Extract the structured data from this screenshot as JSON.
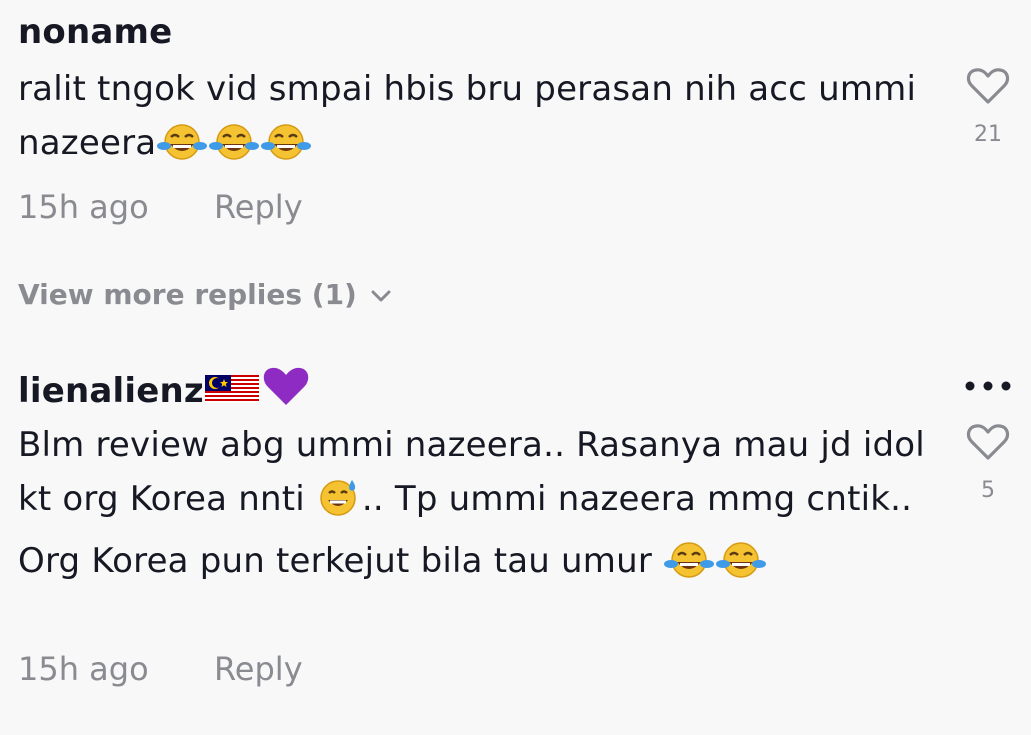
{
  "comments": [
    {
      "username": "noname",
      "text_parts": [
        "ralit tngok vid smpai hbis bru perasan nih acc ummi nazeera"
      ],
      "emojis": [
        "laughing-tears",
        "laughing-tears",
        "laughing-tears"
      ],
      "time": "15h ago",
      "reply_label": "Reply",
      "likes": "21"
    },
    {
      "username": "lienalienz",
      "username_emojis": [
        "malaysia-flag",
        "purple-heart"
      ],
      "text_a": "Blm review abg ummi nazeera.. Rasanya mau jd idol kt org Korea nnti ",
      "text_b": ".. Tp ummi nazeera mmg cntik.. Org Korea pun terkejut bila tau umur ",
      "emoji_mid": "grinning-sweat",
      "emojis_end": [
        "laughing-tears",
        "laughing-tears"
      ],
      "time": "15h ago",
      "reply_label": "Reply",
      "likes": "5"
    }
  ],
  "view_more_label": "View more replies (1)",
  "colors": {
    "text": "#161823",
    "muted": "#8a8b91",
    "background": "#f8f8f8",
    "emoji_yellow": "#f5c232",
    "tear_blue": "#3f9be8",
    "heart_purple": "#8e2bc2"
  }
}
